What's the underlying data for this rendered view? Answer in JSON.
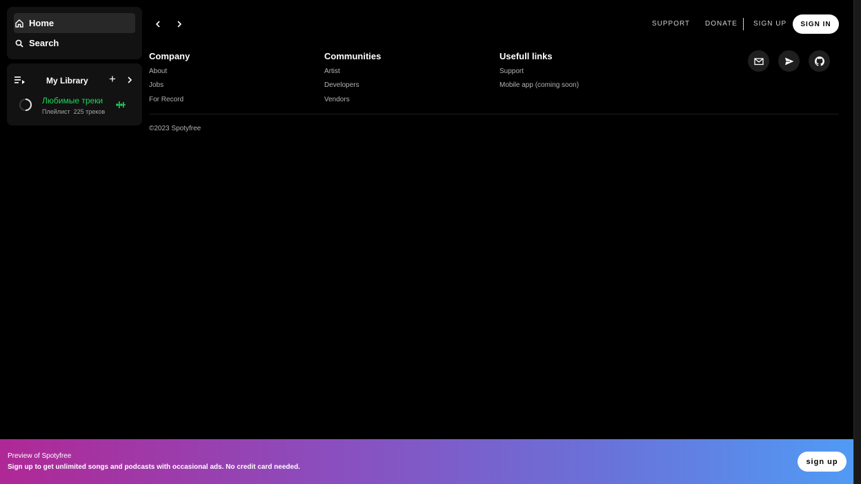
{
  "sidebar": {
    "nav": [
      {
        "label": "Home",
        "icon": "home-icon"
      },
      {
        "label": "Search",
        "icon": "search-icon"
      }
    ],
    "library": {
      "title": "My Library",
      "add_icon": "plus-icon",
      "expand_icon": "chevron-right-icon",
      "playlist": {
        "name": "Любимые треки",
        "type": "Плейлист",
        "count": "225 треков",
        "name_color": "#1ed760"
      }
    }
  },
  "topbar": {
    "back_icon": "chevron-left-icon",
    "forward_icon": "chevron-right-icon",
    "links": [
      "SUPPORT",
      "DONATE",
      "SIGN UP"
    ],
    "signin_label": "SIGN IN"
  },
  "footer": {
    "columns": [
      {
        "title": "Company",
        "links": [
          "About",
          "Jobs",
          "For Record"
        ]
      },
      {
        "title": "Communities",
        "links": [
          "Artist",
          "Developers",
          "Vendors"
        ]
      },
      {
        "title": "Usefull links",
        "links": [
          "Support",
          "Mobile app (coming soon)"
        ]
      }
    ],
    "social_icons": [
      "mail-icon",
      "send-icon",
      "github-icon"
    ],
    "copyright": "©2023 Spotyfree"
  },
  "banner": {
    "title": "Preview of Spotyfree",
    "subtitle": "Sign up to get unlimited songs and podcasts with occasional ads. No credit card needed.",
    "button_label": "sign up",
    "gradient": [
      "#af2896",
      "#509bf5"
    ]
  }
}
